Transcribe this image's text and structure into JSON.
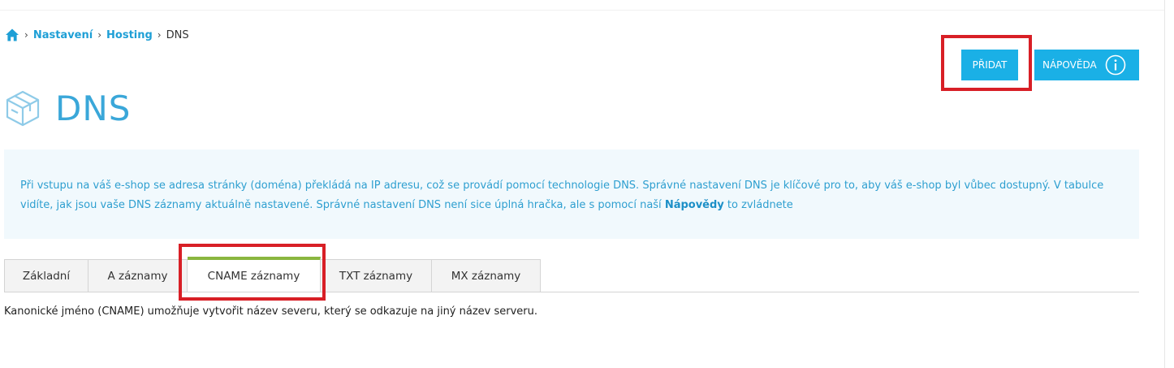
{
  "breadcrumb": {
    "home_icon": "home-icon",
    "items": [
      "Nastavení",
      "Hosting"
    ],
    "current": "DNS",
    "separator": "›"
  },
  "actions": {
    "add_label": "PŘIDAT",
    "help_label": "NÁPOVĚDA",
    "help_icon": "info-icon"
  },
  "page": {
    "title": "DNS",
    "title_icon": "box-icon"
  },
  "info": {
    "text_before": "Při vstupu na váš e-shop se adresa stránky (doména) překládá na IP adresu, což se provádí pomocí technologie DNS. Správné nastavení DNS je klíčové pro to, aby váš e-shop byl vůbec dostupný. V tabulce vidíte, jak jsou vaše DNS záznamy aktuálně nastavené. Správné nastavení DNS není sice úplná hračka, ale s pomocí naší ",
    "link": "Nápovědy",
    "text_after": " to zvládnete"
  },
  "tabs": [
    {
      "label": "Základní"
    },
    {
      "label": "A záznamy"
    },
    {
      "label": "CNAME záznamy",
      "active": true
    },
    {
      "label": "TXT záznamy"
    },
    {
      "label": "MX záznamy"
    }
  ],
  "tab_description": "Kanonické jméno (CNAME) umožňuje vytvořit název severu, který se odkazuje na jiný název serveru.",
  "colors": {
    "accent": "#1ab0e6",
    "title": "#3aa7d9",
    "active_tab": "#8ab63f",
    "highlight": "#d81f26",
    "info_bg": "#f1f9fd"
  }
}
